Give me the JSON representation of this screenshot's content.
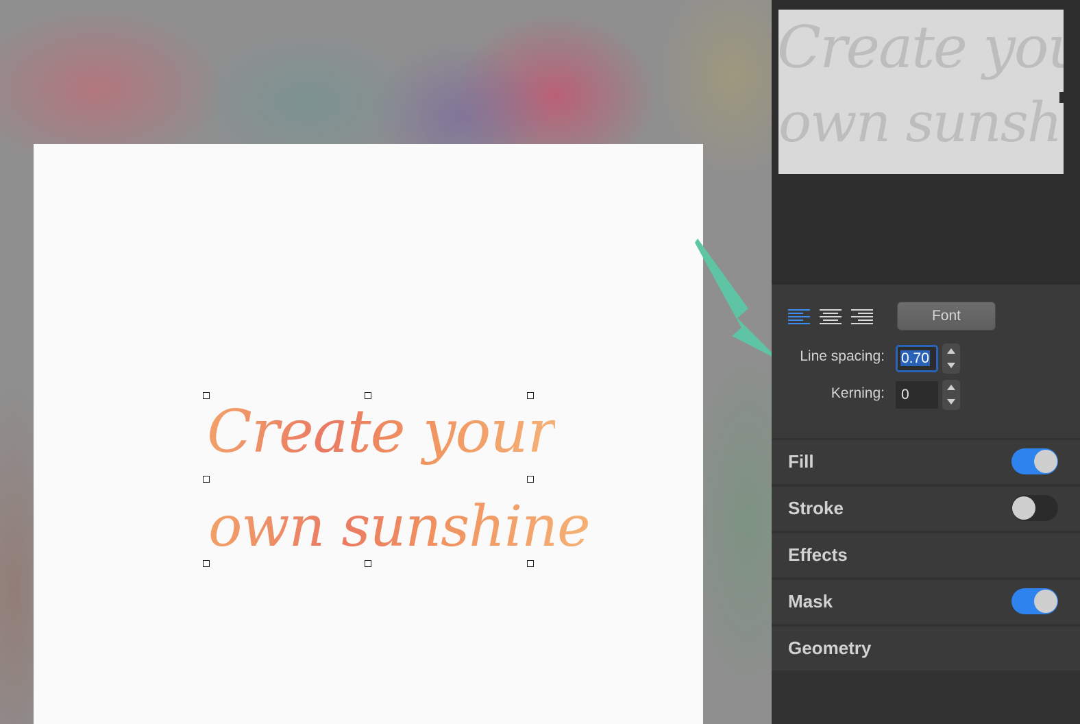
{
  "canvas": {
    "text_line1": "Create your",
    "text_line2": "own sunshine"
  },
  "preview": {
    "line1": "Create your",
    "line2": "own sunshine"
  },
  "text_options": {
    "alignment": [
      "align-left",
      "align-center",
      "align-right"
    ],
    "selected_alignment": "align-left",
    "font_button": "Font",
    "line_spacing_label": "Line spacing:",
    "line_spacing_value": "0.70",
    "kerning_label": "Kerning:",
    "kerning_value": "0"
  },
  "sections": {
    "fill": {
      "label": "Fill",
      "toggle": true
    },
    "stroke": {
      "label": "Stroke",
      "toggle": false
    },
    "effects": {
      "label": "Effects"
    },
    "mask": {
      "label": "Mask",
      "toggle": true
    },
    "geometry": {
      "label": "Geometry"
    }
  },
  "colors": {
    "accent": "#2f83ee",
    "arrow": "#5ec4a4",
    "text_gradient": [
      "#f2a36a",
      "#ea7a63",
      "#f5b276"
    ]
  }
}
